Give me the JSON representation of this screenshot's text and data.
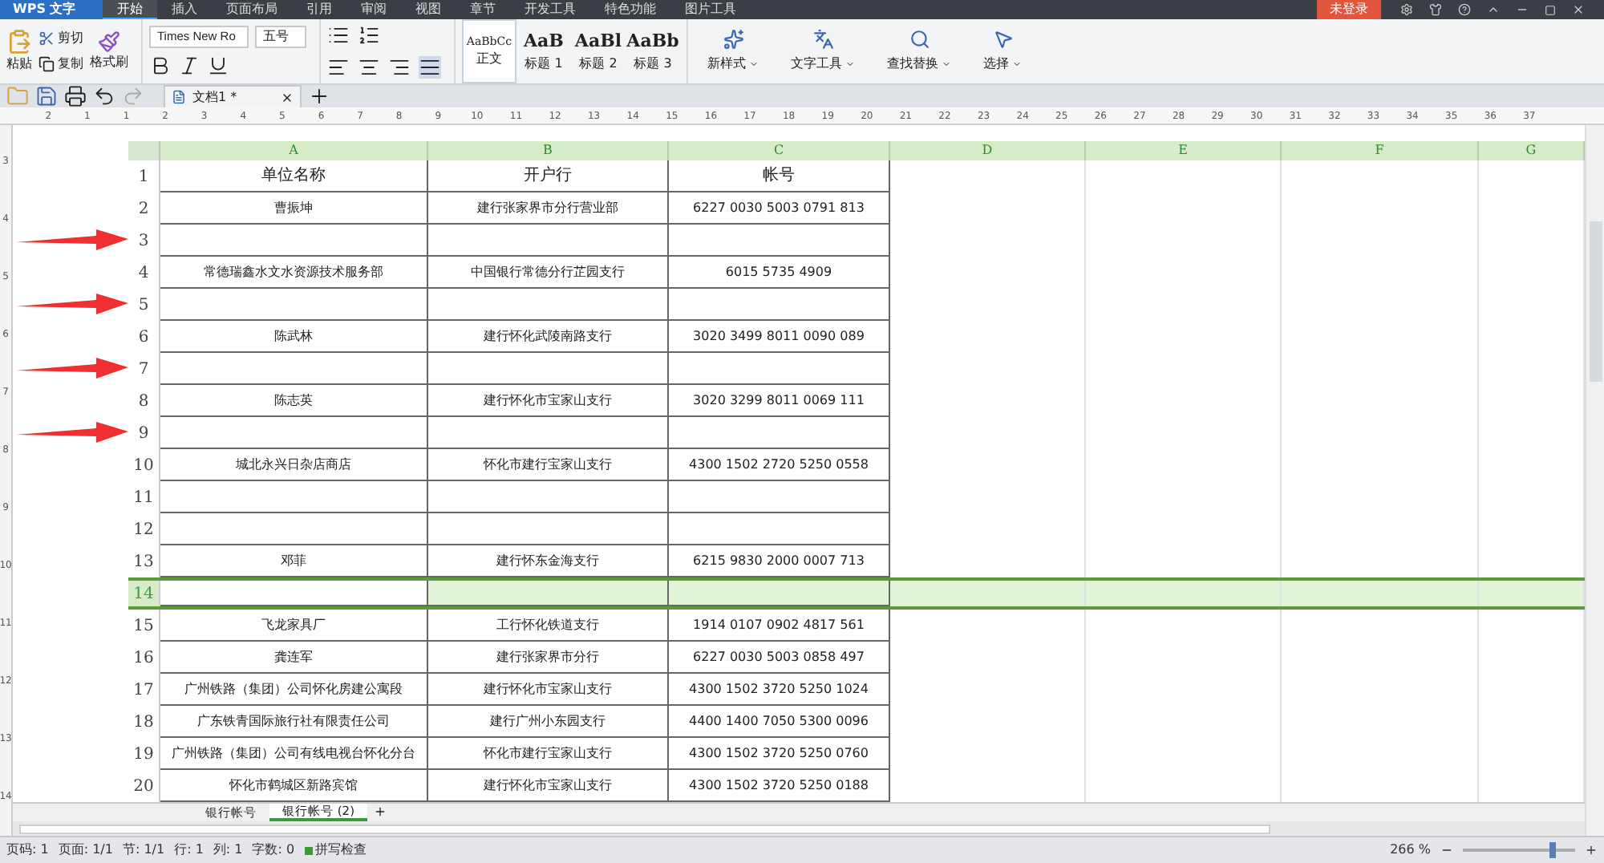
{
  "app": {
    "logo": "WPS 文字"
  },
  "menu_tabs": [
    {
      "label": "开始",
      "selected": true
    },
    {
      "label": "插入",
      "selected": false
    },
    {
      "label": "页面布局",
      "selected": false
    },
    {
      "label": "引用",
      "selected": false
    },
    {
      "label": "审阅",
      "selected": false
    },
    {
      "label": "视图",
      "selected": false
    },
    {
      "label": "章节",
      "selected": false
    },
    {
      "label": "开发工具",
      "selected": false
    },
    {
      "label": "特色功能",
      "selected": false
    },
    {
      "label": "图片工具",
      "selected": false
    }
  ],
  "login_button": "未登录",
  "ribbon": {
    "paste": "粘贴",
    "cut": "剪切",
    "copy": "复制",
    "format_painter": "格式刷",
    "font_name": "Times New Ro",
    "font_size": "五号",
    "styles": [
      {
        "preview": "AaBbCc",
        "label": "正文",
        "selected": true
      },
      {
        "preview": "AaB",
        "label": "标题 1",
        "selected": false
      },
      {
        "preview": "AaBl",
        "label": "标题 2",
        "selected": false
      },
      {
        "preview": "AaBb",
        "label": "标题 3",
        "selected": false
      }
    ],
    "big_buttons": [
      {
        "kind": "style",
        "label": "新样式"
      },
      {
        "kind": "text",
        "label": "文字工具"
      },
      {
        "kind": "find",
        "label": "查找替换"
      },
      {
        "kind": "select",
        "label": "选择"
      }
    ]
  },
  "document_tab": {
    "title": "文档1 *"
  },
  "ruler": [
    "2",
    "1",
    "1",
    "2",
    "3",
    "4",
    "5",
    "6",
    "7",
    "8",
    "9",
    "10",
    "11",
    "12",
    "13",
    "14",
    "15",
    "16",
    "17",
    "18",
    "19",
    "20",
    "21",
    "22",
    "23",
    "24",
    "25",
    "26",
    "27",
    "28",
    "29",
    "30",
    "31",
    "32",
    "33",
    "34",
    "35",
    "36",
    "37"
  ],
  "vertical_ruler": [
    "3",
    "4",
    "5",
    "6",
    "7",
    "8",
    "9",
    "10",
    "11",
    "12",
    "13",
    "14"
  ],
  "table": {
    "columns": [
      "A",
      "B",
      "C",
      "D",
      "E",
      "F",
      "G"
    ],
    "rows": [
      {
        "number": "1",
        "selected": false,
        "arrow": false,
        "cells": [
          "单位名称",
          "开户行",
          "帐号"
        ]
      },
      {
        "number": "2",
        "selected": false,
        "arrow": false,
        "cells": [
          "曹振坤",
          "建行张家界市分行营业部",
          "6227 0030 5003 0791 813"
        ]
      },
      {
        "number": "3",
        "selected": false,
        "arrow": true,
        "cells": []
      },
      {
        "number": "4",
        "selected": false,
        "arrow": false,
        "cells": [
          "常德瑞鑫水文水资源技术服务部",
          "中国银行常德分行芷园支行",
          "6015 5735 4909"
        ]
      },
      {
        "number": "5",
        "selected": false,
        "arrow": true,
        "cells": []
      },
      {
        "number": "6",
        "selected": false,
        "arrow": false,
        "cells": [
          "陈武林",
          "建行怀化武陵南路支行",
          "3020 3499 8011 0090 089"
        ]
      },
      {
        "number": "7",
        "selected": false,
        "arrow": true,
        "cells": []
      },
      {
        "number": "8",
        "selected": false,
        "arrow": false,
        "cells": [
          "陈志英",
          "建行怀化市宝家山支行",
          "3020 3299 8011 0069 111"
        ]
      },
      {
        "number": "9",
        "selected": false,
        "arrow": true,
        "cells": []
      },
      {
        "number": "10",
        "selected": false,
        "arrow": false,
        "cells": [
          "城北永兴日杂店商店",
          "怀化市建行宝家山支行",
          "4300 1502 2720 5250 0558"
        ]
      },
      {
        "number": "11",
        "selected": false,
        "arrow": false,
        "cells": []
      },
      {
        "number": "12",
        "selected": false,
        "arrow": false,
        "cells": []
      },
      {
        "number": "13",
        "selected": false,
        "arrow": false,
        "cells": [
          "邓菲",
          "建行怀东金海支行",
          "6215 9830 2000 0007 713"
        ]
      },
      {
        "number": "14",
        "selected": true,
        "arrow": false,
        "cells": []
      },
      {
        "number": "15",
        "selected": false,
        "arrow": false,
        "cells": [
          "飞龙家具厂",
          "工行怀化铁道支行",
          "1914 0107 0902 4817 561"
        ]
      },
      {
        "number": "16",
        "selected": false,
        "arrow": false,
        "cells": [
          "龚连军",
          "建行张家界市分行",
          "6227 0030 5003 0858 497"
        ]
      },
      {
        "number": "17",
        "selected": false,
        "arrow": false,
        "cells": [
          "广州铁路（集团）公司怀化房建公寓段",
          "建行怀化市宝家山支行",
          "4300 1502 3720 5250 1024"
        ]
      },
      {
        "number": "18",
        "selected": false,
        "arrow": false,
        "cells": [
          "广东铁青国际旅行社有限责任公司",
          "建行广州小东园支行",
          "4400 1400 7050 5300 0096"
        ]
      },
      {
        "number": "19",
        "selected": false,
        "arrow": false,
        "cells": [
          "广州铁路（集团）公司有线电视台怀化分台",
          "怀化市建行宝家山支行",
          "4300 1502 3720 5250 0760"
        ]
      },
      {
        "number": "20",
        "selected": false,
        "arrow": false,
        "cells": [
          "怀化市鹤城区新路宾馆",
          "建行怀化市宝家山支行",
          "4300 1502 3720 5250 0188"
        ]
      }
    ]
  },
  "sheet_tabs": [
    {
      "label": "银行帐号",
      "selected": false
    },
    {
      "label": "银行帐号 (2)",
      "selected": true
    }
  ],
  "status_bar": {
    "items": [
      "页码: 1",
      "页面: 1/1",
      "节: 1/1",
      "行: 1",
      "列: 1",
      "字数: 0"
    ],
    "spell_check": "拼写检查",
    "zoom": "266 %",
    "zoom_level": {
      "level": 0.8
    }
  }
}
